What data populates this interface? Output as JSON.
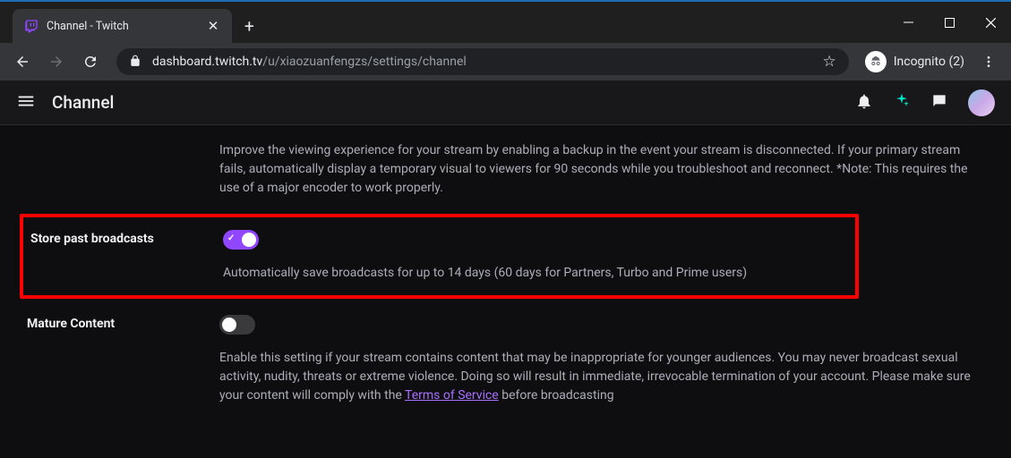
{
  "window": {
    "tab_title": "Channel - Twitch",
    "incognito_label": "Incognito (2)"
  },
  "url": {
    "host": "dashboard.twitch.tv",
    "path": "/u/xiaozuanfengzs/settings/channel"
  },
  "header": {
    "title": "Channel"
  },
  "settings": {
    "disconnect": {
      "desc": "Improve the viewing experience for your stream by enabling a backup in the event your stream is disconnected. If your primary stream fails, automatically display a temporary visual to viewers for 90 seconds while you troubleshoot and reconnect. *Note: This requires the use of a major encoder to work properly."
    },
    "store": {
      "label": "Store past broadcasts",
      "desc": "Automatically save broadcasts for up to 14 days (60 days for Partners, Turbo and Prime users)",
      "toggle": true
    },
    "mature": {
      "label": "Mature Content",
      "desc_before": "Enable this setting if your stream contains content that may be inappropriate for younger audiences. You may never broadcast sexual activity, nudity, threats or extreme violence. Doing so will result in immediate, irrevocable termination of your account. Please make sure your content will comply with the ",
      "tos_link": "Terms of Service",
      "desc_after": " before broadcasting",
      "toggle": false
    }
  }
}
